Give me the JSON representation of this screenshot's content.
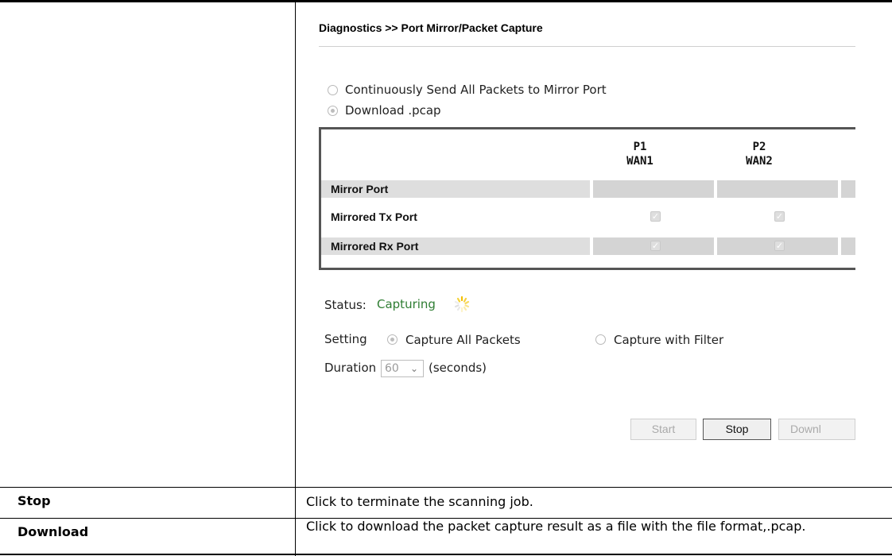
{
  "screenshot": {
    "title": "Diagnostics >> Port Mirror/Packet Capture",
    "mode_options": [
      "Continuously Send All Packets to Mirror Port",
      "Download .pcap"
    ],
    "selected_mode": "Download .pcap",
    "table": {
      "headers": [
        {
          "port": "P1",
          "name": "WAN1"
        },
        {
          "port": "P2",
          "name": "WAN2"
        }
      ],
      "rows": [
        "Mirror Port",
        "Mirrored Tx Port",
        "Mirrored Rx Port"
      ]
    },
    "status_label": "Status:",
    "status_value": "Capturing",
    "setting_label": "Setting",
    "setting_options": [
      "Capture All Packets",
      "Capture with Filter"
    ],
    "selected_setting": "Capture All Packets",
    "duration_label": "Duration",
    "duration_value": "60",
    "duration_unit": "(seconds)",
    "buttons": {
      "start": "Start",
      "stop": "Stop",
      "download": "Downl"
    }
  },
  "descriptions": [
    {
      "term": "Stop",
      "text": "Click to terminate the scanning job."
    },
    {
      "term": "Download",
      "text": "Click to download the packet capture result as a file with the file format,.pcap."
    }
  ],
  "colors": {
    "status": "#2e7d32",
    "row_shade": "#dedede"
  }
}
